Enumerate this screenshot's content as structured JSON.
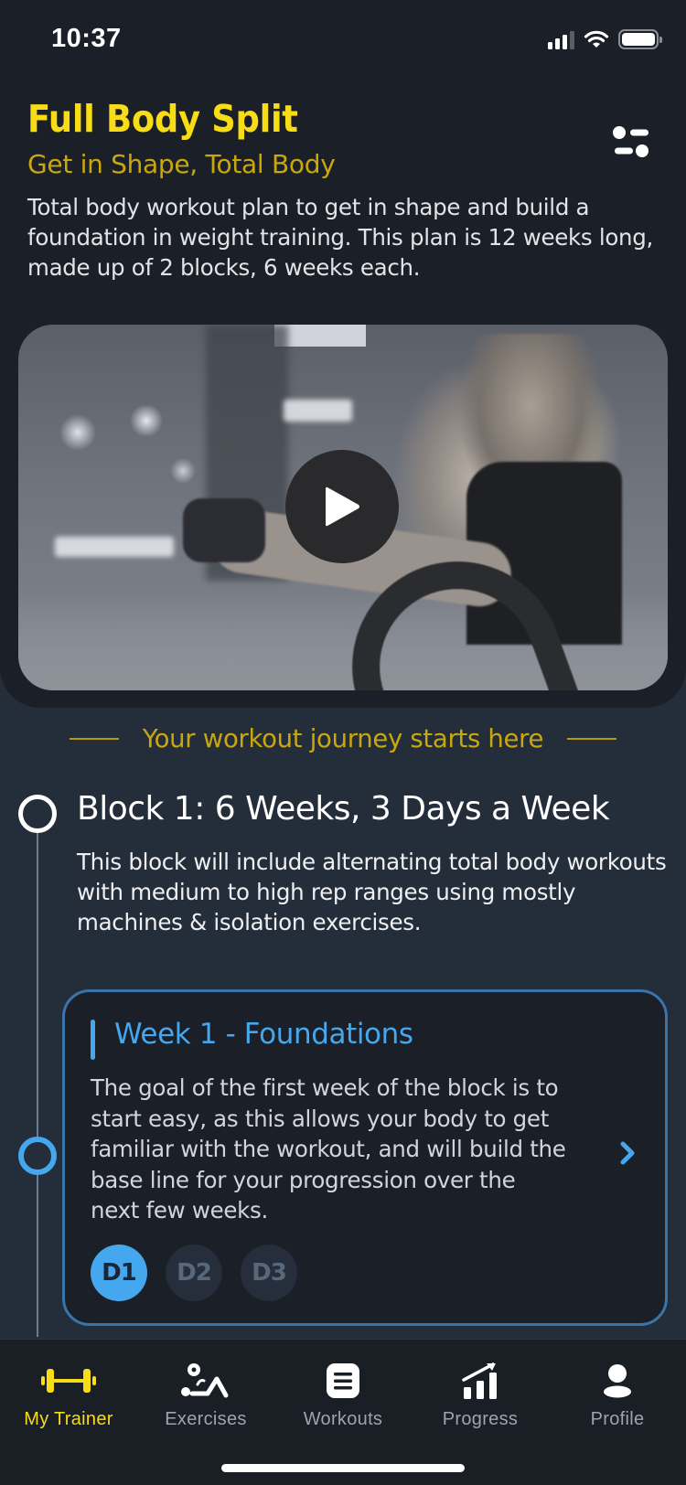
{
  "status_bar": {
    "time": "10:37",
    "icons": [
      "cellular-signal-icon",
      "wifi-icon",
      "battery-icon"
    ]
  },
  "header": {
    "title": "Full Body Split",
    "subtitle": "Get in Shape, Total Body",
    "description": "Total body workout plan to get in shape and build a foundation in weight training. This plan is 12 weeks long, made up of 2 blocks, 6 weeks each.",
    "filter_icon": "sliders-icon"
  },
  "video": {
    "play_icon": "play-icon"
  },
  "journey_label": "Your workout journey starts here",
  "block": {
    "title": "Block 1: 6 Weeks, 3 Days a Week",
    "description": "This block will include alternating total body workouts with medium to high rep ranges using mostly machines & isolation exercises."
  },
  "week": {
    "title": "Week 1 - Foundations",
    "description": "The goal of the first week of the block is to start easy, as this allows your body to get familiar with the workout, and will build the base line for your progression over the next few weeks.",
    "days": [
      {
        "label": "D1",
        "active": true
      },
      {
        "label": "D2",
        "active": false
      },
      {
        "label": "D3",
        "active": false
      }
    ]
  },
  "tabbar": {
    "items": [
      {
        "label": "My Trainer",
        "icon": "dumbbell-icon",
        "active": true
      },
      {
        "label": "Exercises",
        "icon": "exercise-icon",
        "active": false
      },
      {
        "label": "Workouts",
        "icon": "list-icon",
        "active": false
      },
      {
        "label": "Progress",
        "icon": "chart-icon",
        "active": false
      },
      {
        "label": "Profile",
        "icon": "person-icon",
        "active": false
      }
    ]
  },
  "colors": {
    "accent_yellow": "#f7dc16",
    "subtitle_gold": "#c9a80f",
    "accent_blue": "#45a7ee",
    "background": "#242d3a",
    "surface": "#1b1f27"
  }
}
